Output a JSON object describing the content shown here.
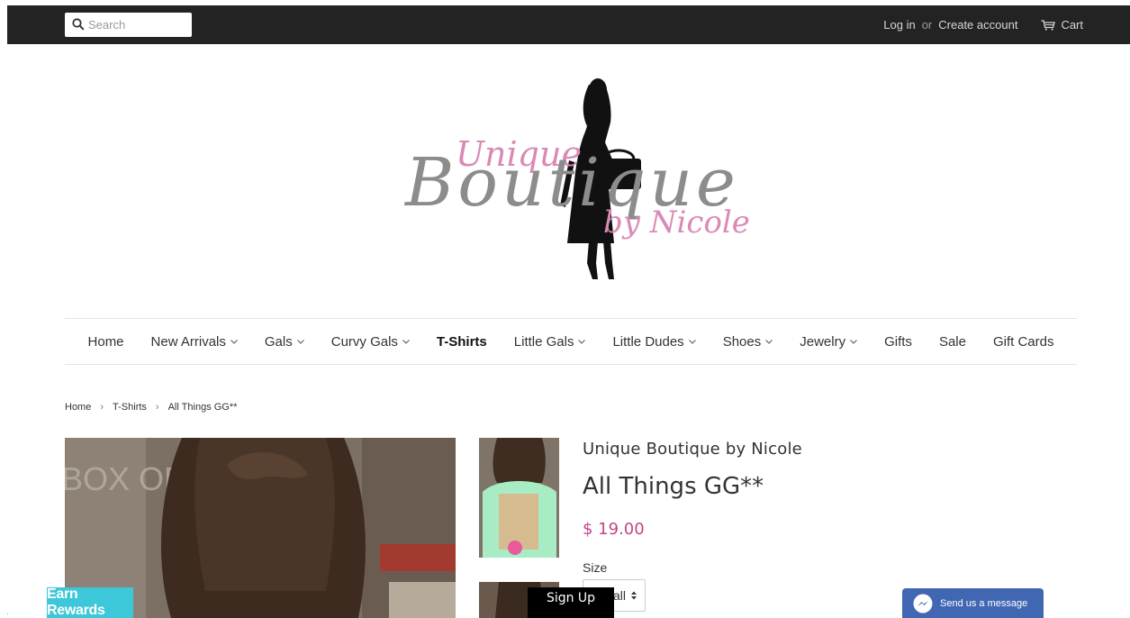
{
  "header": {
    "search_placeholder": "Search",
    "login_label": "Log in",
    "or_label": "or",
    "create_account_label": "Create account",
    "cart_label": "Cart"
  },
  "logo": {
    "line1": "Unique",
    "line2": "Boutique",
    "line3": "by Nicole"
  },
  "nav": {
    "items": [
      {
        "label": "Home",
        "dropdown": false
      },
      {
        "label": "New Arrivals",
        "dropdown": true
      },
      {
        "label": "Gals",
        "dropdown": true
      },
      {
        "label": "Curvy Gals",
        "dropdown": true
      },
      {
        "label": "T-Shirts",
        "dropdown": false,
        "active": true
      },
      {
        "label": "Little Gals",
        "dropdown": true
      },
      {
        "label": "Little Dudes",
        "dropdown": true
      },
      {
        "label": "Shoes",
        "dropdown": true
      },
      {
        "label": "Jewelry",
        "dropdown": true
      },
      {
        "label": "Gifts",
        "dropdown": false
      },
      {
        "label": "Sale",
        "dropdown": false
      },
      {
        "label": "Gift Cards",
        "dropdown": false
      }
    ]
  },
  "breadcrumb": {
    "home": "Home",
    "sep": "›",
    "collection": "T-Shirts",
    "current": "All Things GG**"
  },
  "product": {
    "vendor": "Unique Boutique by Nicole",
    "title": "All Things GG**",
    "price": "$ 19.00",
    "size_label": "Size",
    "size_value": "Small"
  },
  "overlays": {
    "earn_rewards": "Earn Rewards",
    "sign_up": "Sign Up",
    "messenger": "Send us a message"
  },
  "colors": {
    "topbar": "#232323",
    "price": "#c0468a",
    "earn_rewards_bg": "#3cc8d8",
    "messenger_bg": "#4267b2"
  }
}
